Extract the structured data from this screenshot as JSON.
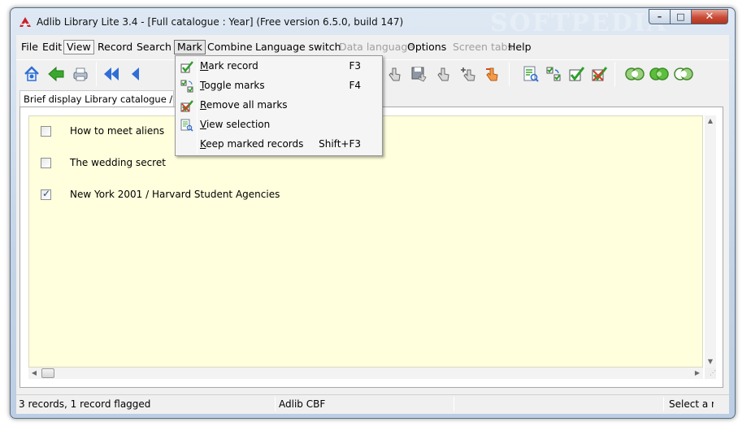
{
  "window": {
    "title": "Adlib Library Lite 3.4  - [Full catalogue : Year] (Free version 6.5.0, build 147)",
    "watermark": "SOFTPEDIA",
    "min_symbol": "–",
    "max_symbol": "□",
    "close_symbol": "✕"
  },
  "menu": {
    "file": "File",
    "edit": "Edit",
    "view": "View",
    "record": "Record",
    "search": "Search",
    "mark": "Mark",
    "combine": "Combine",
    "language_switch": "Language switch",
    "data_language": "Data language",
    "options": "Options",
    "screen_tabs": "Screen tabs",
    "help": "Help"
  },
  "toolbar": {
    "icons": [
      "home-icon",
      "back-arrow-icon",
      "print-icon",
      "first-record-icon",
      "previous-record-icon",
      "hand-pointer-icon",
      "save-icon",
      "select-hand-icon",
      "add-hand-icon",
      "pointer-hand-icon",
      "view-selection-icon",
      "toggle-marks-icon",
      "mark-record-icon",
      "remove-marks-icon",
      "combine-and-icon",
      "combine-or-icon",
      "combine-not-icon"
    ],
    "colors": {
      "arrow_blue": "#2f6fd6",
      "arrow_green": "#3aa82c",
      "check_green": "#2e9e2a",
      "mark_red": "#d63a2a",
      "circle_green": "#5bbf3a"
    }
  },
  "tab": {
    "label": "Brief display Library catalogue / Document"
  },
  "records": [
    {
      "title": "How to meet aliens",
      "checked": false
    },
    {
      "title": "The wedding secret",
      "checked": false
    },
    {
      "title": "New York 2001 / Harvard Student Agencies",
      "checked": true
    }
  ],
  "checkmark": "✓",
  "status": {
    "summary": "3 records, 1 record flagged",
    "database": "Adlib CBF",
    "hint": "Select a re"
  },
  "mark_menu": {
    "items": [
      {
        "prefix": "",
        "accel": "M",
        "rest": "ark record",
        "shortcut": "F3"
      },
      {
        "prefix": "",
        "accel": "T",
        "rest": "oggle marks",
        "shortcut": "F4"
      },
      {
        "prefix": "",
        "accel": "R",
        "rest": "emove all marks",
        "shortcut": ""
      },
      {
        "prefix": "",
        "accel": "V",
        "rest": "iew selection",
        "shortcut": ""
      },
      {
        "prefix": "",
        "accel": "K",
        "rest": "eep marked records",
        "shortcut": "Shift+F3"
      }
    ]
  },
  "colors": {
    "list_background": "#ffffdd",
    "menu_highlight": "#e6e6e6"
  }
}
